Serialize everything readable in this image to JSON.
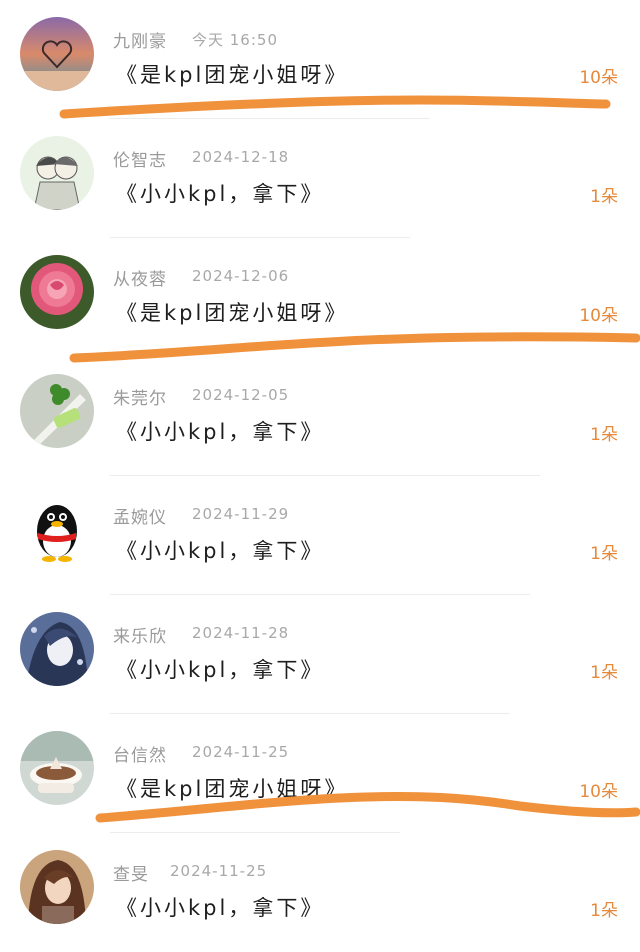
{
  "gifts": [
    {
      "name": "九刚豪",
      "date": "今天 16:50",
      "message": "《是kpl团宠小姐呀》",
      "count": "10朵",
      "avatar": "heart-sunset-avatar"
    },
    {
      "name": "伦智志",
      "date": "2024-12-18",
      "message": "《小小kpl，拿下》",
      "count": "1朵",
      "avatar": "sketch-couple-avatar"
    },
    {
      "name": "从夜蓉",
      "date": "2024-12-06",
      "message": "《是kpl团宠小姐呀》",
      "count": "10朵",
      "avatar": "pink-rose-avatar"
    },
    {
      "name": "朱莞尔",
      "date": "2024-12-05",
      "message": "《小小kpl，拿下》",
      "count": "1朵",
      "avatar": "clover-good-luck-avatar"
    },
    {
      "name": "孟婉仪",
      "date": "2024-11-29",
      "message": "《小小kpl，拿下》",
      "count": "1朵",
      "avatar": "penguin-avatar"
    },
    {
      "name": "来乐欣",
      "date": "2024-11-28",
      "message": "《小小kpl，拿下》",
      "count": "1朵",
      "avatar": "anime-girl-avatar"
    },
    {
      "name": "台信然",
      "date": "2024-11-25",
      "message": "《是kpl团宠小姐呀》",
      "count": "10朵",
      "avatar": "coffee-cup-avatar"
    },
    {
      "name": "查旻",
      "date": "2024-11-25",
      "message": "《小小kpl，拿下》",
      "count": "1朵",
      "avatar": "brown-hair-girl-avatar"
    }
  ],
  "colors": {
    "accent": "#e58a3c",
    "highlight": "#f0913c",
    "name": "#9a9a9a",
    "text": "#1e1e1e"
  }
}
